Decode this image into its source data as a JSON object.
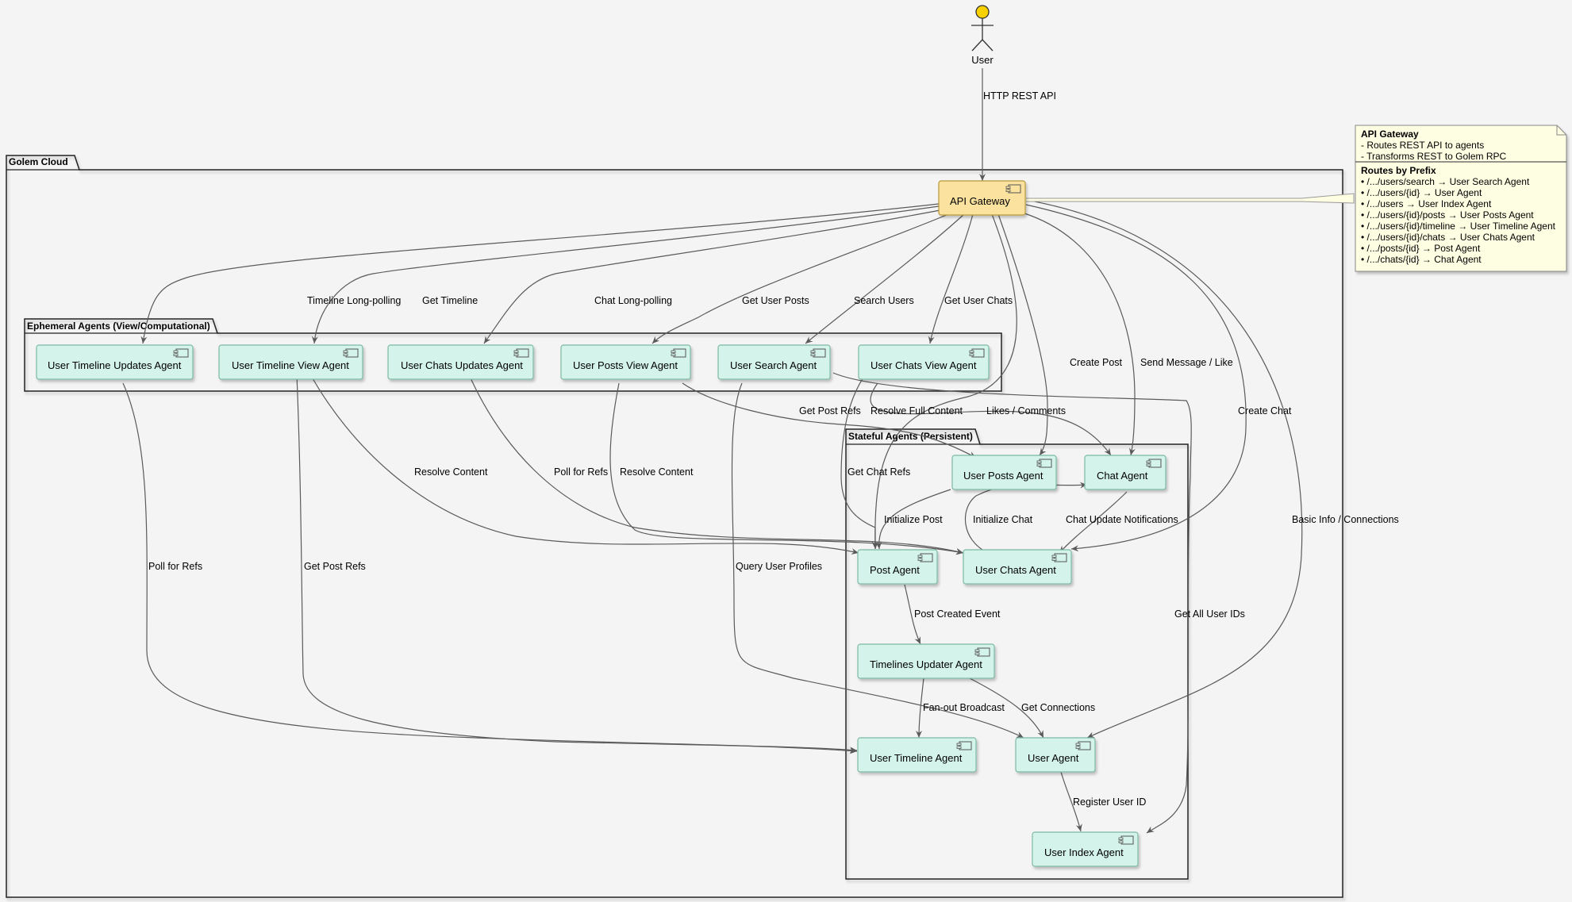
{
  "actor": {
    "label": "User"
  },
  "packages": {
    "cloud": "Golem Cloud",
    "ephemeral": "Ephemeral Agents (View/Computational)",
    "stateful": "Stateful Agents (Persistent)"
  },
  "components": {
    "gateway": "API Gateway",
    "timeline_updates": "User Timeline Updates Agent",
    "timeline_view": "User Timeline View Agent",
    "chats_updates": "User Chats Updates Agent",
    "posts_view": "User Posts View Agent",
    "search": "User Search Agent",
    "chats_view": "User Chats View Agent",
    "user_posts": "User Posts Agent",
    "chat": "Chat Agent",
    "post": "Post Agent",
    "user_chats": "User Chats Agent",
    "timelines_updater": "Timelines Updater Agent",
    "user_timeline": "User Timeline Agent",
    "user": "User Agent",
    "user_index": "User Index Agent"
  },
  "edges": {
    "http_rest": "HTTP REST API",
    "timeline_long_polling": "Timeline Long-polling",
    "get_timeline": "Get Timeline",
    "chat_long_polling": "Chat Long-polling",
    "get_user_posts": "Get User Posts",
    "search_users": "Search Users",
    "get_user_chats": "Get User Chats",
    "create_post": "Create Post",
    "send_message": "Send Message / Like",
    "create_chat": "Create Chat",
    "likes_comments": "Likes / Comments",
    "basic_info": "Basic Info / Connections",
    "get_post_refs_top": "Get Post Refs",
    "resolve_full_content": "Resolve Full Content",
    "get_chat_refs": "Get Chat Refs",
    "resolve_content_1": "Resolve Content",
    "poll_for_refs_1": "Poll for Refs",
    "resolve_content_2": "Resolve Content",
    "initialize_post": "Initialize Post",
    "initialize_chat": "Initialize Chat",
    "chat_update_notifications": "Chat Update Notifications",
    "poll_for_refs_2": "Poll for Refs",
    "get_post_refs_2": "Get Post Refs",
    "query_user_profiles": "Query User Profiles",
    "get_all_user_ids": "Get All User IDs",
    "post_created_event": "Post Created Event",
    "fanout_broadcast": "Fan-out Broadcast",
    "get_connections": "Get Connections",
    "register_user_id": "Register User ID"
  },
  "note": {
    "title": "API Gateway",
    "lines": [
      "- Routes REST API to agents",
      "- Transforms REST to Golem RPC"
    ],
    "routes_title": "Routes by Prefix",
    "routes": [
      "• /.../users/search → User Search Agent",
      "• /.../users/{id} → User Agent",
      "• /.../users → User Index Agent",
      "• /.../users/{id}/posts → User Posts Agent",
      "• /.../users/{id}/timeline → User Timeline Agent",
      "• /.../users/{id}/chats → User Chats Agent",
      "• /.../posts/{id} → Post Agent",
      "• /.../chats/{id} → Chat Agent"
    ]
  },
  "colors": {
    "background": "#f4f4f4",
    "gateway_fill": "#fbe29f",
    "agent_fill": "#d4f3ea",
    "note_fill": "#fefee2",
    "actor_fill": "#f7d102"
  }
}
